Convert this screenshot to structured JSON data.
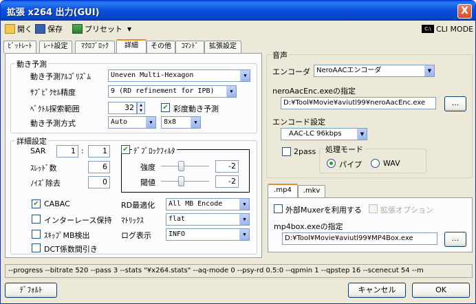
{
  "window": {
    "title": "拡張 x264 出力(GUI)",
    "close": "X"
  },
  "toolbar": {
    "open": "開く",
    "save": "保存",
    "preset": "プリセット",
    "cli_icon": "C:\\",
    "cli_mode": "CLI MODE"
  },
  "tabs": [
    "ﾋﾞｯﾄﾚｰﾄ",
    "ﾚｰﾄ設定",
    "ﾏｸﾛﾌﾞﾛｯｸ",
    "詳細",
    "その他",
    "ｺﾏﾝﾄﾞ",
    "拡張設定"
  ],
  "motion": {
    "group": "動き予測",
    "algo_label": "動き予測ｱﾙｺﾞﾘｽﾞﾑ",
    "algo_value": "Uneven Multi-Hexagon",
    "subpel_label": "ｻﾌﾞﾋﾟｸｾﾙ精度",
    "subpel_value": "9 (RD refinement for IPB)",
    "range_label": "ﾍﾞｸﾄﾙ探索範囲",
    "range_value": "32",
    "chroma_label": "彩度動き予測",
    "method_label": "動き予測方式",
    "method_value": "Auto",
    "partition_value": "8x8"
  },
  "detail": {
    "group": "詳細設定",
    "sar_label": "SAR",
    "sar_x": "1",
    "sar_sep": ":",
    "sar_y": "1",
    "threads_label": "ｽﾚｯﾄﾞ数",
    "threads_value": "6",
    "noise_label": "ﾉｲｽﾞ除去",
    "noise_value": "0",
    "deblock_label": "ﾃﾞﾌﾞﾛｯｸﾌｨﾙﾀ",
    "strength_label": "強度",
    "strength_value": "-2",
    "threshold_label": "閾値",
    "threshold_value": "-2",
    "cabac": "CABAC",
    "interlace": "インターレース保持",
    "skip_mb": "ｽｷｯﾌﾟMB検出",
    "dct": "DCT係数間引き",
    "rd_label": "RD最適化",
    "rd_value": "All MB Encode",
    "matrix_label": "ﾏﾄﾘｯｸｽ",
    "matrix_value": "flat",
    "log_label": "ログ表示",
    "log_value": "INFO"
  },
  "audio": {
    "group": "音声",
    "encoder_label": "エンコーダ",
    "encoder_value": "NeroAACエンコーダ",
    "path_label": "neroAacEnc.exeの指定",
    "path_value": "D:¥Tool¥Movie¥aviutl99¥neroAacEnc.exe",
    "browse": "...",
    "setting_label": "エンコード設定",
    "setting_value": "AAC-LC 96kbps",
    "twopass": "2pass",
    "mode_group": "処理モード",
    "pipe": "パイプ",
    "wav": "WAV"
  },
  "mux": {
    "tabs": [
      ".mp4",
      ".mkv"
    ],
    "external": "外部Muxerを利用する",
    "ext_opt": "拡張オプション",
    "path_label": "mp4box.exeの指定",
    "path_value": "D:¥Tool¥Movie¥aviutl99¥MP4Box.exe",
    "browse": "..."
  },
  "cmdline": "--progress --bitrate 520 --pass 3 --stats \"¥x264.stats\" --aq-mode 0 --psy-rd 0.5:0 --qpmin 1 --qpstep 16 --scenecut 54 --m",
  "buttons": {
    "default": "ﾃﾞﾌｫﾙﾄ",
    "cancel": "キャンセル",
    "ok": "OK"
  },
  "checks": {
    "mark": "✔"
  },
  "colors": {
    "titlebar": "#0a5ee9",
    "panel": "#fcfcfe",
    "face": "#ece9d8",
    "accent": "#e68b2c",
    "check": "#21a121"
  }
}
